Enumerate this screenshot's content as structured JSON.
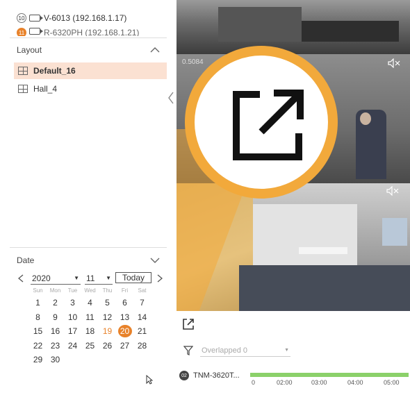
{
  "device_list": [
    {
      "number": "10",
      "label": "V-6013 (192.168.1.17)"
    },
    {
      "number": "11",
      "label": "R-6320PH (192.168.1.21)"
    }
  ],
  "layout_section": {
    "title": "Layout",
    "items": [
      {
        "label": "Default_16",
        "selected": true
      },
      {
        "label": "Hall_4",
        "selected": false
      }
    ]
  },
  "date_section": {
    "title": "Date",
    "year": "2020",
    "month": "11",
    "today_label": "Today",
    "weekdays": [
      "Sun",
      "Mon",
      "Tue",
      "Wed",
      "Thu",
      "Fri",
      "Sat"
    ],
    "weeks": [
      [
        "1",
        "2",
        "3",
        "4",
        "5",
        "6",
        "7"
      ],
      [
        "8",
        "9",
        "10",
        "11",
        "12",
        "13",
        "14"
      ],
      [
        "15",
        "16",
        "17",
        "18",
        "19",
        "20",
        "21"
      ],
      [
        "22",
        "23",
        "24",
        "25",
        "26",
        "27",
        "28"
      ],
      [
        "29",
        "30",
        "",
        "",
        "",
        "",
        ""
      ]
    ],
    "highlighted_day": "19",
    "selected_day": "20"
  },
  "video": {
    "tile_label": "0.5084"
  },
  "filter": {
    "placeholder": "Overlapped 0"
  },
  "timeline": {
    "device_badge": "02",
    "device_label": "TNM-3620T...",
    "ticks": [
      "0",
      "02:00",
      "03:00",
      "04:00",
      "05:00"
    ]
  },
  "colors": {
    "accent": "#e8822a",
    "popout_ring": "#f2a93b",
    "selected_row": "#fbe1d2",
    "timeline_fill": "#8bd16a"
  },
  "icons": {
    "popout": "external-link-icon",
    "filter": "filter-icon",
    "mute": "speaker-mute-icon"
  }
}
